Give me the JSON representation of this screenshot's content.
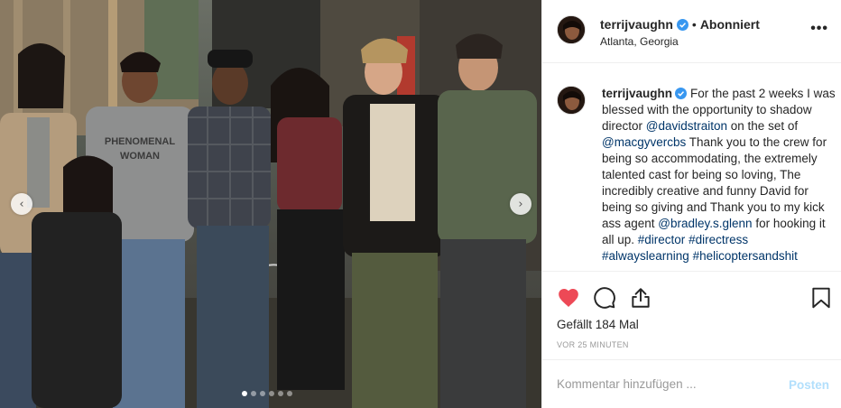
{
  "post": {
    "username": "terrijvaughn",
    "separator": "•",
    "follow_state": "Abonniert",
    "location": "Atlanta, Georgia",
    "more_icon": "more-horizontal-icon",
    "verified_icon": "verified-badge-icon",
    "verified_color": "#3897f0"
  },
  "caption": {
    "username": "terrijvaughn",
    "parts": [
      "For the past 2 weeks I was blessed with the opportunity to shadow director ",
      "@davidstraiton",
      " on the set of ",
      "@macgyvercbs",
      " Thank you to the crew for being so accommodating, the extremely talented cast for being so loving, The incredibly creative and funny David for being so giving and Thank you to my kick ass agent ",
      "@bradley.s.glenn",
      " for hooking it all up. ",
      "#director",
      " ",
      "#directress",
      " ",
      "#alwayslearning",
      " ",
      "#helicoptersandshit"
    ]
  },
  "actions": {
    "like_icon": "heart-filled-icon",
    "like_color": "#ed4956",
    "comment_icon": "comment-icon",
    "share_icon": "share-icon",
    "save_icon": "bookmark-icon",
    "likes_text": "Gefällt 184 Mal",
    "timestamp": "VOR 25 MINUTEN"
  },
  "comment": {
    "placeholder": "Kommentar hinzufügen ...",
    "post_label": "Posten"
  },
  "carousel": {
    "prev_icon": "chevron-left-icon",
    "next_icon": "chevron-right-icon",
    "prev_glyph": "‹",
    "next_glyph": "›",
    "total_slides": 6,
    "active_slide": 1
  },
  "photo": {
    "shirt_text_line1": "PHENOMENAL",
    "shirt_text_line2": "WOMAN"
  }
}
